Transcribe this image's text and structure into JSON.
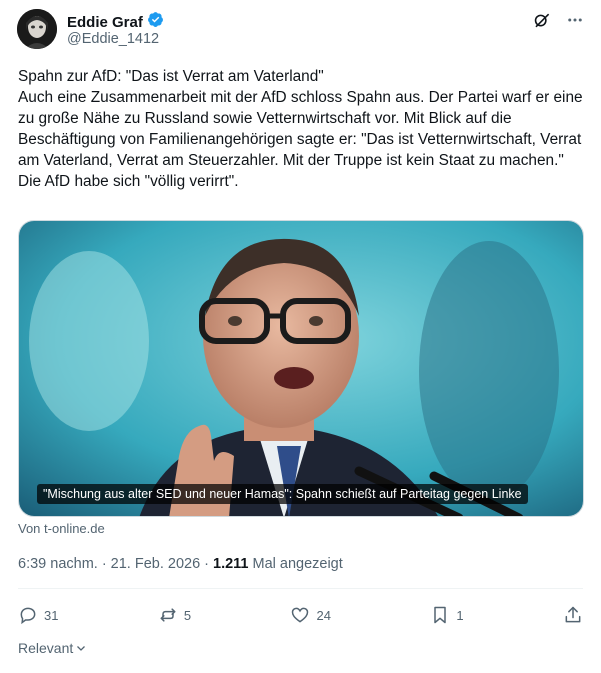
{
  "author": {
    "display_name": "Eddie Graf",
    "handle": "@Eddie_1412",
    "verified_badge_color": "#1d9bf0"
  },
  "header_actions": {
    "grok_icon": "grok-icon",
    "more_icon": "more-icon"
  },
  "tweet": {
    "paragraphs": [
      "Spahn zur AfD: \"Das ist Verrat am Vaterland\"",
      "Auch eine Zusammenarbeit mit der AfD schloss Spahn aus. Der Partei warf er eine zu große Nähe zu Russland sowie Vetternwirtschaft vor. Mit Blick auf die Beschäftigung von Familienangehörigen sagte er: \"Das ist Vetternwirtschaft, Verrat am Vaterland, Verrat am Steuerzahler. Mit der Truppe ist kein Staat zu machen.\" Die AfD habe sich \"völlig verirrt\"."
    ]
  },
  "media": {
    "caption": "\"Mischung aus alter SED und neuer Hamas\": Spahn schießt auf Parteitag gegen Linke",
    "source": "Von t-online.de"
  },
  "meta": {
    "time": "6:39 nachm.",
    "separator1": "·",
    "date": "21. Feb. 2026",
    "separator2": "·",
    "views_count": "1.211",
    "views_label": "Mal angezeigt"
  },
  "actions": {
    "replies": "31",
    "reposts": "5",
    "likes": "24",
    "bookmarks": "1"
  },
  "sort": {
    "label": "Relevant"
  },
  "colors": {
    "text": "#0f1419",
    "secondary": "#536471",
    "border": "#eff3f4",
    "accent": "#1d9bf0"
  }
}
